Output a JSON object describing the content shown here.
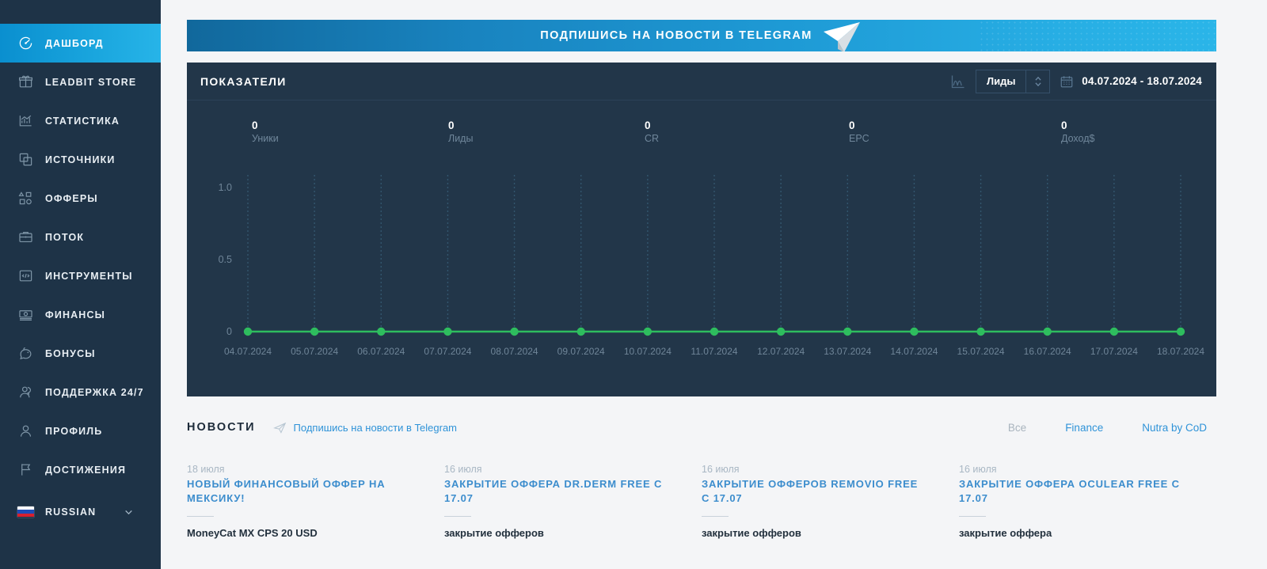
{
  "sidebar": {
    "items": [
      {
        "label": "ДАШБОРД",
        "icon": "dashboard-icon",
        "active": true
      },
      {
        "label": "LEADBIT STORE",
        "icon": "store-icon",
        "active": false
      },
      {
        "label": "СТАТИСТИКА",
        "icon": "statistics-icon",
        "active": false
      },
      {
        "label": "ИСТОЧНИКИ",
        "icon": "sources-icon",
        "active": false
      },
      {
        "label": "ОФФЕРЫ",
        "icon": "offers-icon",
        "active": false
      },
      {
        "label": "ПОТОК",
        "icon": "flow-icon",
        "active": false
      },
      {
        "label": "ИНСТРУМЕНТЫ",
        "icon": "tools-icon",
        "active": false
      },
      {
        "label": "ФИНАНСЫ",
        "icon": "finance-icon",
        "active": false
      },
      {
        "label": "БОНУСЫ",
        "icon": "bonus-icon",
        "active": false
      },
      {
        "label": "ПОДДЕРЖКА 24/7",
        "icon": "support-icon",
        "active": false
      },
      {
        "label": "ПРОФИЛЬ",
        "icon": "profile-icon",
        "active": false
      },
      {
        "label": "ДОСТИЖЕНИЯ",
        "icon": "achievements-icon",
        "active": false
      }
    ],
    "language": {
      "label": "RUSSIAN",
      "flag": "russia-flag-icon",
      "caret": "chevron-down-icon"
    }
  },
  "banner": {
    "text": "ПОДПИШИСЬ НА НОВОСТИ В          TELEGRAM",
    "icon": "telegram-plane-icon",
    "color_from": "#11689c",
    "color_to": "#2ab5e8"
  },
  "panel": {
    "title": "ПОКАЗАТЕЛИ",
    "chart_type_icon": "chart-area-icon",
    "metric_select": {
      "value": "Лиды",
      "caret": "chevron-up-down-icon"
    },
    "date_range": {
      "icon": "calendar-icon",
      "value": "04.07.2024 - 18.07.2024"
    },
    "kpis": [
      {
        "value": "0",
        "label": "Уники"
      },
      {
        "value": "0",
        "label": "Лиды"
      },
      {
        "value": "0",
        "label": "CR"
      },
      {
        "value": "0",
        "label": "EPC"
      },
      {
        "value": "0",
        "label": "Доход$"
      }
    ]
  },
  "chart_data": {
    "type": "line",
    "title": "ПОКАЗАТЕЛИ",
    "xlabel": "",
    "ylabel": "",
    "ylim": [
      0,
      1.0
    ],
    "yticks": [
      "0",
      "0.5",
      "1.0"
    ],
    "grid": true,
    "legend": false,
    "series_color": "#2ebd5e",
    "categories": [
      "04.07.2024",
      "05.07.2024",
      "06.07.2024",
      "07.07.2024",
      "08.07.2024",
      "09.07.2024",
      "10.07.2024",
      "11.07.2024",
      "12.07.2024",
      "13.07.2024",
      "14.07.2024",
      "15.07.2024",
      "16.07.2024",
      "17.07.2024",
      "18.07.2024"
    ],
    "series": [
      {
        "name": "Лиды",
        "values": [
          0,
          0,
          0,
          0,
          0,
          0,
          0,
          0,
          0,
          0,
          0,
          0,
          0,
          0,
          0
        ]
      }
    ]
  },
  "news": {
    "title": "НОВОСТИ",
    "subscribe": {
      "icon": "telegram-plane-icon",
      "text": "Подпишись на новости в Telegram"
    },
    "filters": [
      {
        "label": "Все",
        "active": true
      },
      {
        "label": "Finance",
        "active": false
      },
      {
        "label": "Nutra by CoD",
        "active": false
      }
    ],
    "cards": [
      {
        "date": "18 июля",
        "title": "НОВЫЙ ФИНАНСОВЫЙ ОФФЕР НА МЕКСИКУ!",
        "body": "MoneyCat MX CPS 20 USD"
      },
      {
        "date": "16 июля",
        "title": "ЗАКРЫТИЕ ОФФЕРА DR.DERM FREE С 17.07",
        "body": "закрытие офферов"
      },
      {
        "date": "16 июля",
        "title": "ЗАКРЫТИЕ ОФФЕРОВ REMOVIO FREE С 17.07",
        "body": "закрытие офферов"
      },
      {
        "date": "16 июля",
        "title": "ЗАКРЫТИЕ ОФФЕРА OCULEAR FREE С 17.07",
        "body": "закрытие оффера"
      }
    ]
  }
}
